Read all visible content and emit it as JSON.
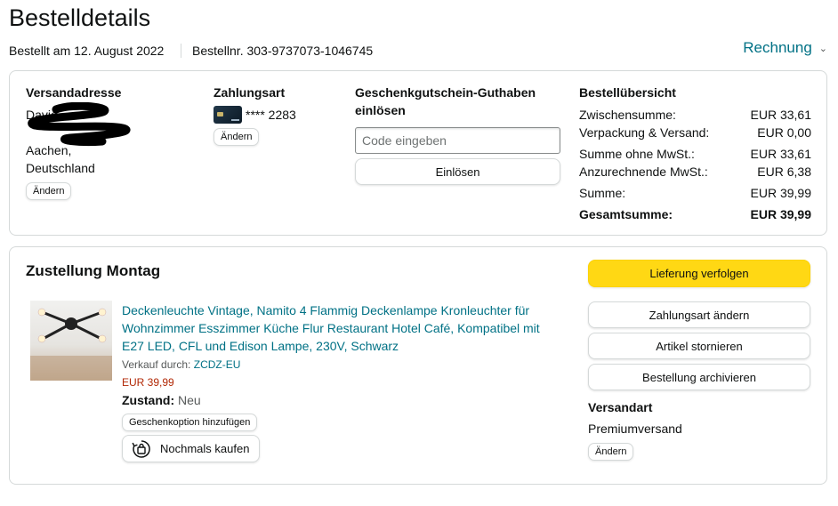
{
  "page": {
    "title": "Bestelldetails",
    "ordered_on": "Bestellt am 12. August 2022",
    "order_number": "Bestellnr. 303-9737073-1046745",
    "invoice_label": "Rechnung"
  },
  "shipping_address": {
    "heading": "Versandadresse",
    "name": "David",
    "city": "Aachen,",
    "country": "Deutschland",
    "edit_label": "Ändern"
  },
  "payment": {
    "heading": "Zahlungsart",
    "card_digits": "**** 2283",
    "edit_label": "Ändern"
  },
  "gift_card": {
    "heading_line1": "Geschenkgutschein-Guthaben",
    "heading_line2": "einlösen",
    "placeholder": "Code eingeben",
    "redeem_label": "Einlösen"
  },
  "summary": {
    "heading": "Bestellübersicht",
    "rows": [
      {
        "label": "Zwischensumme:",
        "value": "EUR 33,61"
      },
      {
        "label": "Verpackung & Versand:",
        "value": "EUR 0,00"
      },
      {
        "label": "Summe ohne MwSt.:",
        "value": "EUR 33,61"
      },
      {
        "label": "Anzurechnende MwSt.:",
        "value": "EUR 6,38"
      },
      {
        "label": "Summe:",
        "value": "EUR 39,99"
      }
    ],
    "total_label": "Gesamtsumme:",
    "total_value": "EUR 39,99"
  },
  "delivery": {
    "heading": "Zustellung Montag",
    "product": {
      "title_line1": "Deckenleuchte Vintage, Namito 4 Flammig Deckenlampe Kronleuchter für",
      "title_line2": "Wohnzimmer Esszimmer Küche Flur Restaurant Hotel Café, Kompatibel mit",
      "title_line3": "E27 LED, CFL und Edison Lampe, 230V, Schwarz",
      "sold_by_label": "Verkauf durch:",
      "seller": "ZCDZ-EU",
      "price": "EUR 39,99",
      "condition_label": "Zustand:",
      "condition_value": "Neu",
      "gift_option_label": "Geschenkoption hinzufügen",
      "buy_again_label": "Nochmals kaufen"
    },
    "actions": {
      "track": "Lieferung verfolgen",
      "change_payment": "Zahlungsart ändern",
      "cancel_items": "Artikel stornieren",
      "archive_order": "Bestellung archivieren"
    },
    "shipping_method": {
      "heading": "Versandart",
      "value": "Premiumversand",
      "edit_label": "Ändern"
    }
  },
  "colors": {
    "link": "#007185",
    "price": "#b12704",
    "primary_button": "#ffd814",
    "border": "#d5d9d9"
  },
  "icons": [
    "card-icon",
    "buy-again-icon",
    "chevron-down-icon",
    "product-image"
  ]
}
